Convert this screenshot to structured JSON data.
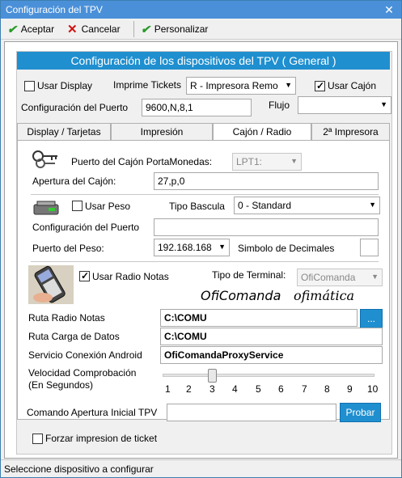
{
  "window": {
    "title": "Configuración del TPV",
    "close_glyph": "✕"
  },
  "toolbar": {
    "accept_label": "Aceptar",
    "cancel_label": "Cancelar",
    "customize_label": "Personalizar"
  },
  "header": {
    "title": "Configuración de los dispositivos del TPV ( General )"
  },
  "general": {
    "use_display_label": "Usar Display",
    "use_display_checked": false,
    "print_tickets_label": "Imprime Tickets",
    "print_tickets_value": "R - Impresora Remo",
    "use_drawer_label": "Usar Cajón",
    "use_drawer_checked": true,
    "port_config_label": "Configuración del Puerto",
    "port_config_value": "9600,N,8,1",
    "flow_label": "Flujo",
    "flow_value": ""
  },
  "tabs": [
    {
      "label": "Display / Tarjetas",
      "active": false
    },
    {
      "label": "Impresión",
      "active": false
    },
    {
      "label": "Cajón / Radio",
      "active": true
    },
    {
      "label": "2ª Impresora",
      "active": false
    }
  ],
  "drawer": {
    "port_label": "Puerto del Cajón PortaMonedas:",
    "port_value": "LPT1:",
    "opening_label": "Apertura del Cajón:",
    "opening_value": "27,p,0"
  },
  "scale": {
    "use_weight_label": "Usar Peso",
    "use_weight_checked": false,
    "type_label": "Tipo Bascula",
    "type_value": "0 - Standard",
    "port_config_label": "Configuración del Puerto",
    "port_config_value": "",
    "weight_port_label": "Puerto del Peso:",
    "weight_port_value": "192.168.168",
    "decimals_label": "Simbolo de Decimales",
    "decimals_value": ""
  },
  "radio": {
    "use_radio_label": "Usar Radio Notas",
    "use_radio_checked": true,
    "terminal_type_label": "Tipo de Terminal:",
    "terminal_type_value": "OfiComanda",
    "brand_text": "OfiComanda",
    "logo_text": "ofimática",
    "path_label": "Ruta Radio Notas",
    "path_value": "C:\\COMU",
    "browse_label": "...",
    "load_path_label": "Ruta Carga de Datos",
    "load_path_value": "C:\\COMU",
    "android_service_label": "Servicio Conexión Android",
    "android_service_value": "OfiComandaProxyService",
    "speed_label_line1": "Velocidad Comprobación",
    "speed_label_line2": "(En Segundos)",
    "speed_value": 3,
    "speed_ticks": [
      "1",
      "2",
      "3",
      "4",
      "5",
      "6",
      "7",
      "8",
      "9",
      "10"
    ]
  },
  "tpv_command": {
    "label": "Comando Apertura Inicial TPV",
    "value": "",
    "test_label": "Probar"
  },
  "force_print": {
    "label": "Forzar impresion de ticket",
    "checked": false
  },
  "status": {
    "text": "Seleccione dispositivo a configurar"
  },
  "colors": {
    "accent": "#1f8fcf",
    "titlebar": "#4a90d9"
  }
}
